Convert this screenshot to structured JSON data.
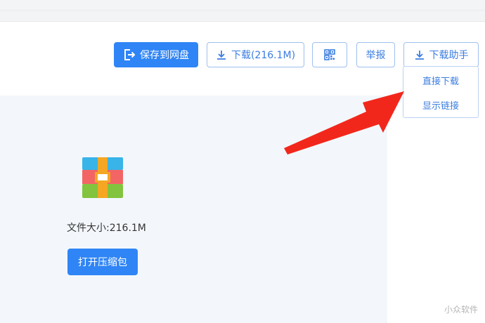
{
  "toolbar": {
    "save_label": "保存到网盘",
    "download_label": "下载(216.1M)",
    "report_label": "举报",
    "helper_label": "下载助手"
  },
  "dropdown": {
    "items": [
      "直接下载",
      "显示链接"
    ]
  },
  "file": {
    "size_text": "文件大小:216.1M",
    "open_label": "打开压缩包"
  },
  "watermark": "小众软件",
  "colors": {
    "primary": "#2f85f5",
    "link": "#3b7de0",
    "arrow": "#f2271c"
  },
  "icons": {
    "save": "save-to-disk-icon",
    "download": "download-icon",
    "qr": "qr-code-icon",
    "helper": "download-icon",
    "archive": "archive-icon"
  }
}
